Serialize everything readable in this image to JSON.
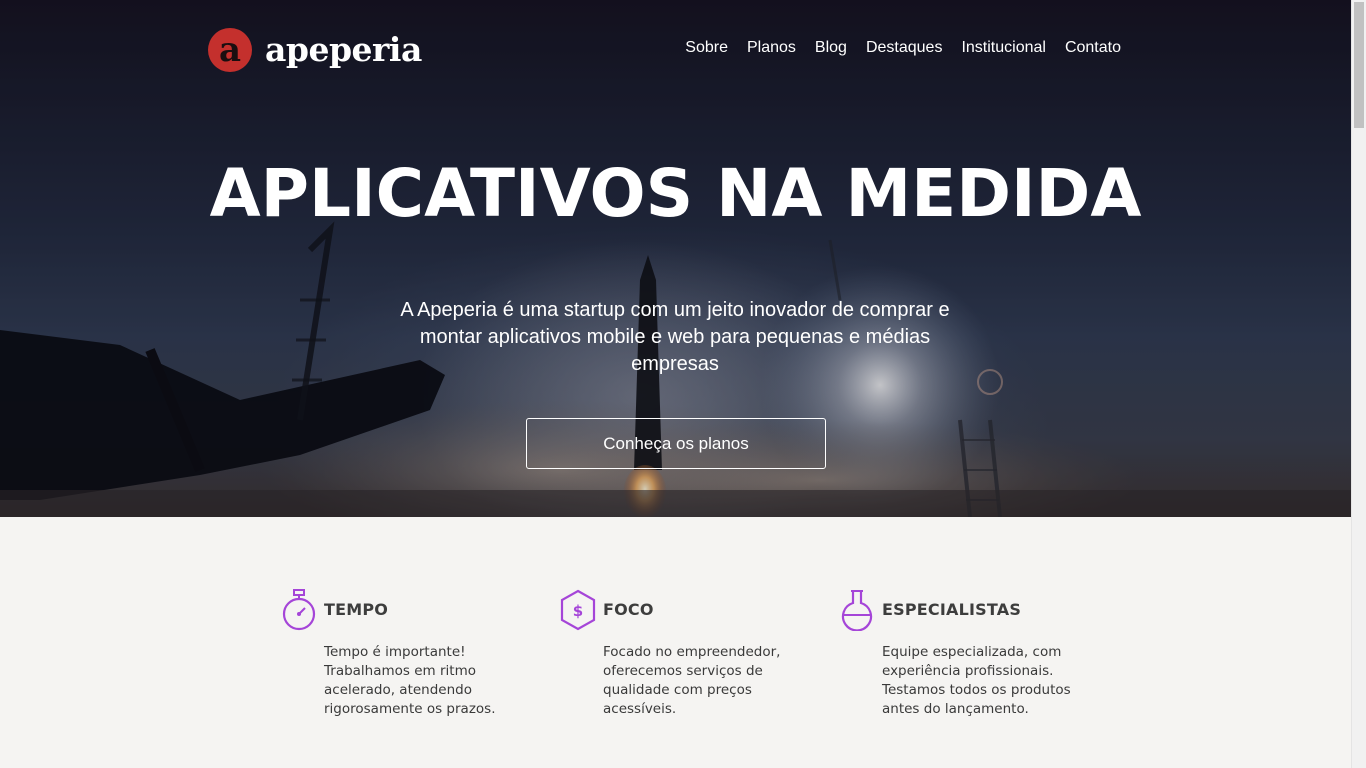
{
  "brand": {
    "logo_letter": "a",
    "name": "apeperia",
    "color": "#c4302d"
  },
  "nav": {
    "items": [
      "Sobre",
      "Planos",
      "Blog",
      "Destaques",
      "Institucional",
      "Contato"
    ]
  },
  "hero": {
    "headline": "APLICATIVOS NA MEDIDA",
    "subheadline": "A Apeperia é uma startup com um jeito inovador de comprar e montar aplicativos mobile e web para pequenas e médias empresas",
    "cta_label": "Conheça os planos",
    "background": "rocket-launch-night-photo"
  },
  "features": [
    {
      "icon": "stopwatch-icon",
      "title": "TEMPO",
      "text": "Tempo é importante! Trabalhamos em ritmo acelerado, atendendo rigorosamente os prazos."
    },
    {
      "icon": "dollar-hexagon-icon",
      "title": "FOCO",
      "text": "Focado no empreendedor, oferecemos serviços de qualidade com preços acessíveis."
    },
    {
      "icon": "flask-icon",
      "title": "ESPECIALISTAS",
      "text": "Equipe especializada, com experiência profissionais. Testamos todos os produtos antes do lançamento."
    }
  ],
  "colors": {
    "accent": "#a545d8",
    "features_bg": "#f5f4f2",
    "text_dark": "#3d3d3d"
  }
}
